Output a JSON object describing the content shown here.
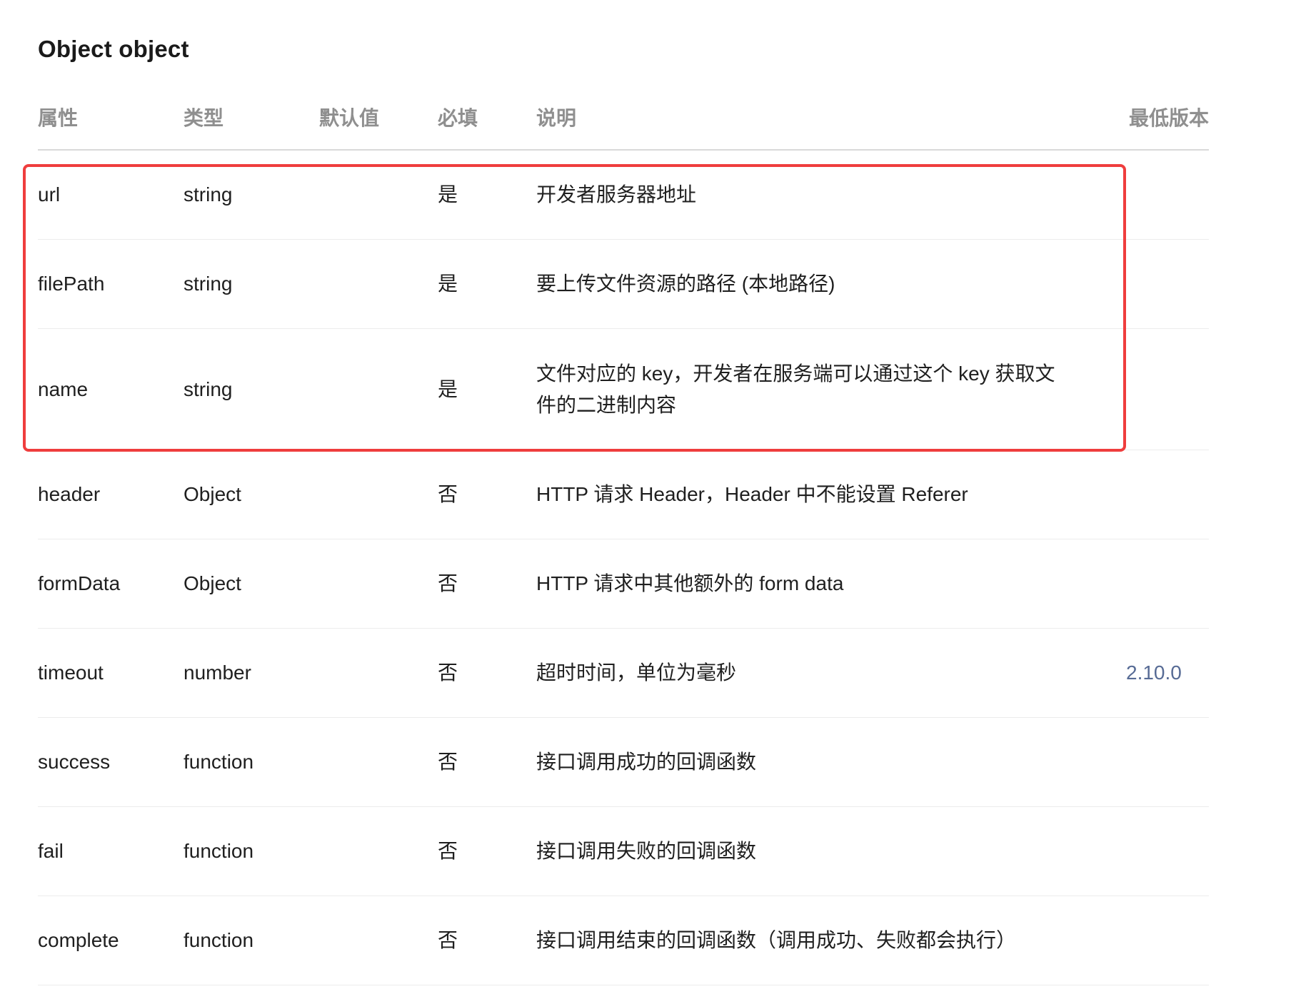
{
  "section": {
    "title": "Object object"
  },
  "table": {
    "headers": {
      "attr": "属性",
      "type": "类型",
      "default": "默认值",
      "required": "必填",
      "desc": "说明",
      "version": "最低版本"
    },
    "rows": [
      {
        "attr": "url",
        "type": "string",
        "default": "",
        "required": "是",
        "desc": "开发者服务器地址",
        "version": ""
      },
      {
        "attr": "filePath",
        "type": "string",
        "default": "",
        "required": "是",
        "desc": "要上传文件资源的路径 (本地路径)",
        "version": ""
      },
      {
        "attr": "name",
        "type": "string",
        "default": "",
        "required": "是",
        "desc": "文件对应的 key，开发者在服务端可以通过这个 key 获取文件的二进制内容",
        "version": ""
      },
      {
        "attr": "header",
        "type": "Object",
        "default": "",
        "required": "否",
        "desc": "HTTP 请求 Header，Header 中不能设置 Referer",
        "version": ""
      },
      {
        "attr": "formData",
        "type": "Object",
        "default": "",
        "required": "否",
        "desc": "HTTP 请求中其他额外的 form data",
        "version": ""
      },
      {
        "attr": "timeout",
        "type": "number",
        "default": "",
        "required": "否",
        "desc": "超时时间，单位为毫秒",
        "version": "2.10.0"
      },
      {
        "attr": "success",
        "type": "function",
        "default": "",
        "required": "否",
        "desc": "接口调用成功的回调函数",
        "version": ""
      },
      {
        "attr": "fail",
        "type": "function",
        "default": "",
        "required": "否",
        "desc": "接口调用失败的回调函数",
        "version": ""
      },
      {
        "attr": "complete",
        "type": "function",
        "default": "",
        "required": "否",
        "desc": "接口调用结束的回调函数（调用成功、失败都会执行）",
        "version": ""
      }
    ]
  },
  "highlight": {
    "color": "#ef3d3d"
  },
  "colors": {
    "version_link": "#576b95",
    "header_text": "#8f8f8f"
  }
}
